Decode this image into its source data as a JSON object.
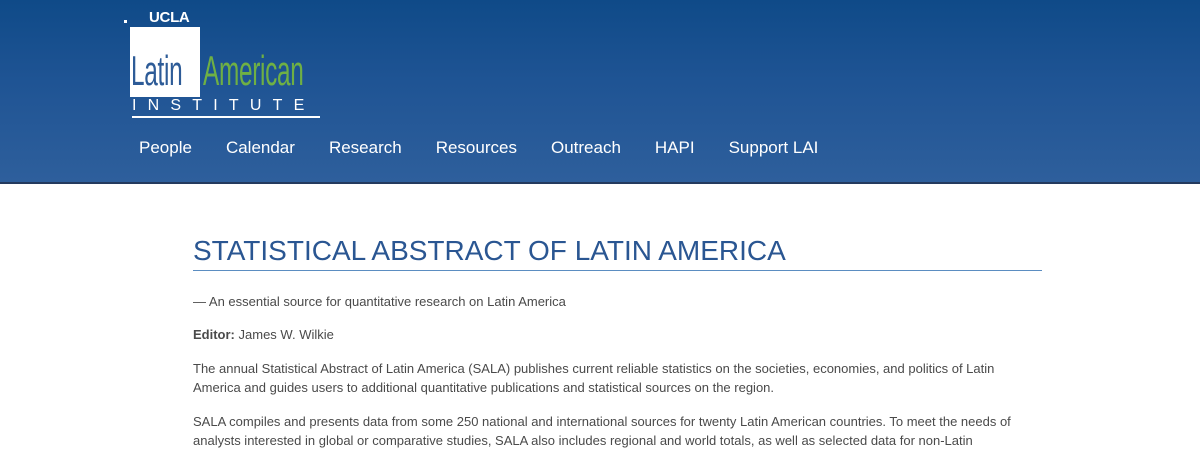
{
  "header": {
    "logo": {
      "ucla": "UCLA",
      "latin": "Latin",
      "american": "American",
      "institute": "INSTITUTE"
    },
    "nav": [
      {
        "label": "People"
      },
      {
        "label": "Calendar"
      },
      {
        "label": "Research"
      },
      {
        "label": "Resources"
      },
      {
        "label": "Outreach"
      },
      {
        "label": "HAPI"
      },
      {
        "label": "Support LAI"
      }
    ]
  },
  "main": {
    "title": "STATISTICAL ABSTRACT OF LATIN AMERICA",
    "subtitle": "— An essential source for quantitative research on Latin America",
    "editor_label": "Editor:",
    "editor_name": "James W. Wilkie",
    "paragraphs": [
      "The annual Statistical Abstract of Latin America (SALA) publishes current reliable statistics on the societies, economies, and politics of Latin America and guides users to additional quantitative publications and statistical sources on the region.",
      "SALA compiles and presents data from some 250 national and international sources for twenty Latin American countries. To meet the needs of analysts interested in global or comparative studies, SALA also includes regional and world totals, as well as selected data for non-Latin"
    ]
  },
  "colors": {
    "header_bg": "#1f5494",
    "logo_green": "#6fb044",
    "title_blue": "#2a5692"
  }
}
